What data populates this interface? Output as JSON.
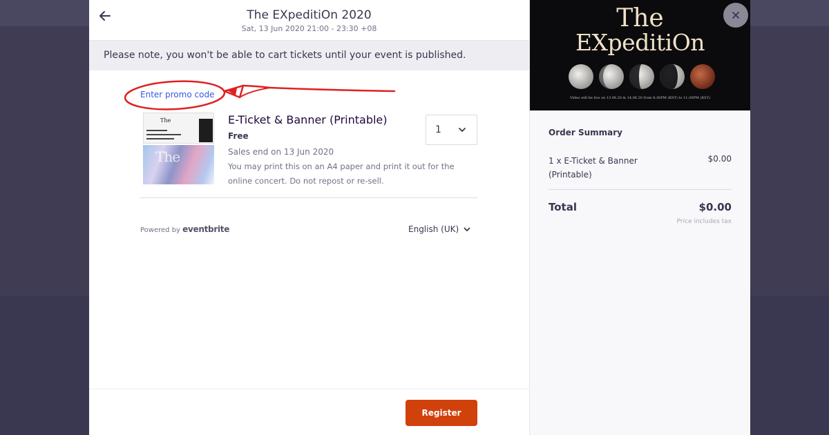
{
  "modal": {
    "event_title": "The EXpeditiOn 2020",
    "event_date": "Sat, 13 Jun 2020 21:00 - 23:30 +08",
    "notice": "Please note, you won't be able to cart tickets until your event is published.",
    "promo_link": "Enter promo code",
    "ticket": {
      "name": "E-Ticket & Banner (Printable)",
      "price": "Free",
      "sales_end": "Sales end on 13 Jun 2020",
      "description": "You may print this on an A4 paper and print it out for the online concert. Do not repost or re-sell.",
      "quantity": "1"
    },
    "powered_by": {
      "prefix": "Powered by",
      "brand": "eventbrite"
    },
    "language": "English (UK)",
    "register_label": "Register"
  },
  "banner": {
    "title_line_1": "The",
    "title_line_2": "EXpeditiOn",
    "caption": "Video will be live on 13.06.20 & 14.06.20 from 8:30PM (KST) to 11:30PM (KST)"
  },
  "order_summary": {
    "heading": "Order Summary",
    "line_item_label": "1 x E-Ticket & Banner (Printable)",
    "line_item_price": "$0.00",
    "total_label": "Total",
    "total_value": "$0.00",
    "tax_note": "Price includes tax"
  },
  "icons": {
    "back": "arrow-left-icon",
    "close": "close-icon",
    "qty_chevron": "chevron-down-icon",
    "lang_chevron": "chevron-down-icon"
  },
  "colors": {
    "accent": "#d1410c",
    "link": "#3659e3",
    "annotation": "#e02020",
    "overlay": "#3d3a50"
  }
}
